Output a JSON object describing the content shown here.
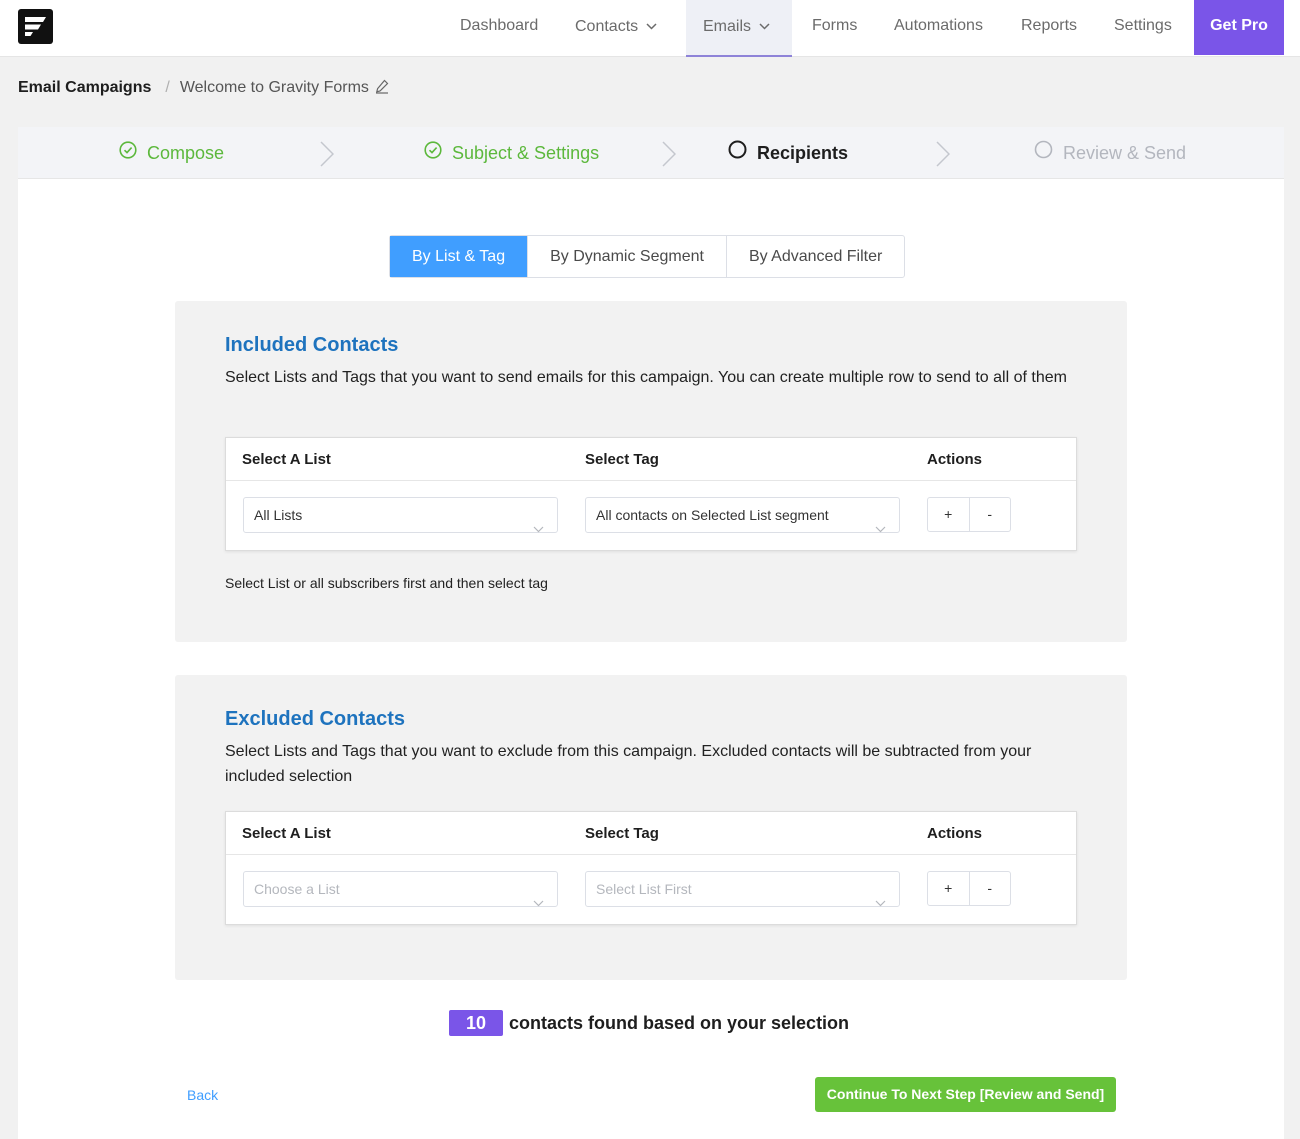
{
  "nav": {
    "items": [
      {
        "label": "Dashboard"
      },
      {
        "label": "Contacts"
      },
      {
        "label": "Emails"
      },
      {
        "label": "Forms"
      },
      {
        "label": "Automations"
      },
      {
        "label": "Reports"
      },
      {
        "label": "Settings"
      }
    ],
    "active": "Emails",
    "get_pro": "Get Pro"
  },
  "breadcrumb": {
    "root": "Email Campaigns",
    "separator": "/",
    "current": "Welcome to Gravity Forms"
  },
  "steps": [
    {
      "label": "Compose",
      "state": "done"
    },
    {
      "label": "Subject & Settings",
      "state": "done"
    },
    {
      "label": "Recipients",
      "state": "current"
    },
    {
      "label": "Review & Send",
      "state": "todo"
    }
  ],
  "tabs": [
    {
      "label": "By List & Tag",
      "active": true
    },
    {
      "label": "By Dynamic Segment",
      "active": false
    },
    {
      "label": "By Advanced Filter",
      "active": false
    }
  ],
  "included": {
    "title": "Included Contacts",
    "description": "Select Lists and Tags that you want to send emails for this campaign. You can create multiple row to send to all of them",
    "headers": {
      "list": "Select A List",
      "tag": "Select Tag",
      "actions": "Actions"
    },
    "list_value": "All Lists",
    "tag_value": "All contacts on Selected List segment",
    "add": "+",
    "remove": "-",
    "hint": "Select List or all subscribers first and then select tag"
  },
  "excluded": {
    "title": "Excluded Contacts",
    "description": "Select Lists and Tags that you want to exclude from this campaign. Excluded contacts will be subtracted from your included selection",
    "headers": {
      "list": "Select A List",
      "tag": "Select Tag",
      "actions": "Actions"
    },
    "list_placeholder": "Choose a List",
    "tag_placeholder": "Select List First",
    "add": "+",
    "remove": "-"
  },
  "summary": {
    "count": "10",
    "text": "contacts found based on your selection"
  },
  "footer": {
    "back": "Back",
    "continue": "Continue To Next Step [Review and Send]"
  },
  "colors": {
    "accent": "#7a55e8",
    "primary": "#409eff",
    "success": "#67c23a",
    "title_blue": "#1e73be"
  }
}
